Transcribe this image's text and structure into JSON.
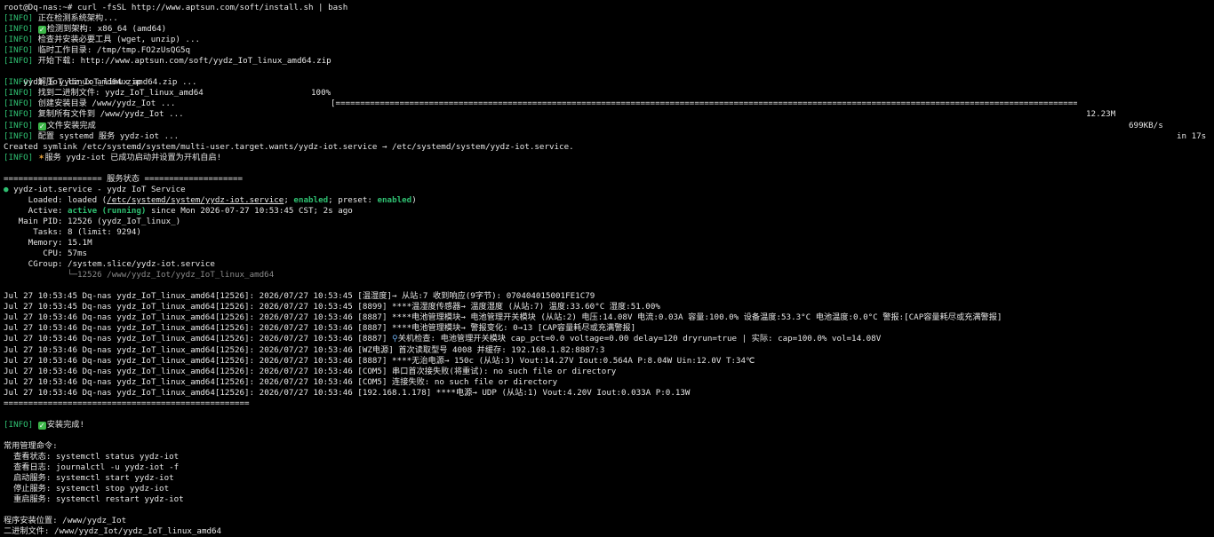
{
  "prompt": "root@Dq-nas:~#",
  "command": "curl -fsSL http://www.aptsun.com/soft/install.sh | bash",
  "info_tag": "[INFO]",
  "check_icon": "check-mark",
  "party_icon": "party-popper",
  "search_icon": "magnifier",
  "install_lines": [
    "正在检测系统架构...",
    "检测到架构: x86_64 (amd64)",
    "检查并安装必要工具 (wget, unzip) ...",
    "临时工作目录: /tmp/tmp.FO2zUsQG5q",
    "开始下载: http://www.aptsun.com/soft/yydz_IoT_linux_amd64.zip"
  ],
  "download": {
    "file": "yydz_IoT_linux_amd64.zip",
    "percent": "100%",
    "bar": "[===================================================================================================================================================================================>]",
    "size": "12.23M",
    "speed": "699KB/s",
    "eta": "in 17s"
  },
  "post_lines": [
    "解压 yydz_IoT_linux_amd64.zip ...",
    "找到二进制文件: yydz_IoT_linux_amd64",
    "创建安装目录 /www/yydz_Iot ...",
    "复制所有文件到 /www/yydz_Iot ..."
  ],
  "file_done": "文件安装完成",
  "configure": "配置 systemd 服务 yydz-iot ...",
  "symlink": "Created symlink /etc/systemd/system/multi-user.target.wants/yydz-iot.service → /etc/systemd/system/yydz-iot.service.",
  "service_started": "服务 yydz-iot 已成功启动并设置为开机自启!",
  "status_header": "==================== 服务状态 ====================",
  "status": {
    "bullet": "●",
    "title": "yydz-iot.service - yydz IoT Service",
    "loaded_label": "     Loaded:",
    "loaded_pre": "loaded (",
    "loaded_path": "/etc/systemd/system/yydz-iot.service",
    "loaded_mid": "; ",
    "enabled": "enabled",
    "preset_label": "; preset: ",
    "preset": "enabled",
    "loaded_end": ")",
    "active_label": "     Active:",
    "active_value": "active (running)",
    "active_since": "since Mon 2026-07-27 10:53:45 CST; 2s ago",
    "pid_label": "   Main PID:",
    "pid_value": "12526 (yydz_IoT_linux_)",
    "tasks_label": "      Tasks:",
    "tasks_value": "8 (limit: 9294)",
    "memory_label": "     Memory:",
    "memory_value": "15.1M",
    "cpu_label": "        CPU:",
    "cpu_value": "57ms",
    "cgroup_label": "     CGroup:",
    "cgroup_value": "/system.slice/yydz-iot.service",
    "cgroup_child": "             └─12526 /www/yydz_Iot/yydz_IoT_linux_amd64"
  },
  "log_prefix_a": "Jul 27 10:53:45 Dq-nas yydz_IoT_linux_amd64[12526]:",
  "log_prefix_b": "Jul 27 10:53:46 Dq-nas yydz_IoT_linux_amd64[12526]:",
  "logs": [
    "2026/07/27 10:53:45 [温湿度]→ 从站:7 收到响应(9字节): 070404015001FE1C79",
    "2026/07/27 10:53:45 [8899] ****温湿度传感器→ 温度湿度 (从站:7) 温度:33.60°C 湿度:51.00%",
    "2026/07/27 10:53:46 [8887] ****电池管理模块→ 电池管理开关模块 (从站:2) 电压:14.08V 电流:0.03A 容量:100.0% 设备温度:53.3°C 电池温度:0.0°C 警报:[CAP容量耗尽或充满警报]",
    "2026/07/27 10:53:46 [8887] ****电池管理模块→ 警报变化: 0→13 [CAP容量耗尽或充满警报]",
    "关机检查: 电池管理开关模块 cap_pct=0.0 voltage=0.00 delay=120 dryrun=true | 实际: cap=100.0% vol=14.08V",
    "2026/07/27 10:53:46 [WZ电源] 首次读取型号 4008 并缓存: 192.168.1.82:8887:3",
    "2026/07/27 10:53:46 [8887] ****无治电源→ 150c (从站:3) Vout:14.27V Iout:0.564A P:8.04W Uin:12.0V T:34℃",
    "2026/07/27 10:53:46 [COM5] 串口首次接失败(将重试): no such file or directory",
    "2026/07/27 10:53:46 [COM5] 连接失败: no such file or directory",
    "2026/07/27 10:53:46 [192.168.1.178] ****电源→ UDP (从站:1) Vout:4.20V Iout:0.033A P:0.13W"
  ],
  "log_search_prefix": "2026/07/27 10:53:46 [8887] ",
  "separator": "==================================================",
  "complete": "安装完成!",
  "commands_title": "常用管理命令:",
  "commands": [
    "  查看状态: systemctl status yydz-iot",
    "  查看日志: journalctl -u yydz-iot -f",
    "  启动服务: systemctl start yydz-iot",
    "  停止服务: systemctl stop yydz-iot",
    "  重启服务: systemctl restart yydz-iot"
  ],
  "install_location": "程序安装位置: /www/yydz_Iot",
  "binary_file": "二进制文件: /www/yydz_Iot/yydz_IoT_linux_amd64"
}
